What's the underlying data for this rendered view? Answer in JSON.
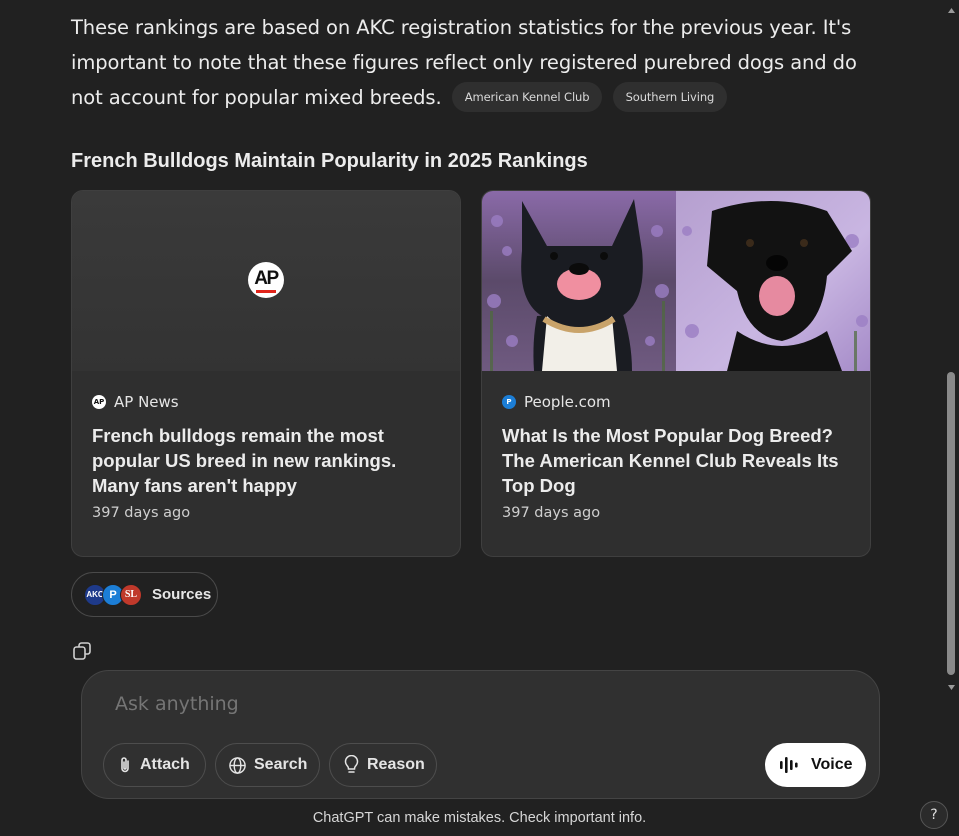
{
  "answer": {
    "paragraph": "These rankings are based on AKC registration statistics for the previous year. It's important to note that these figures reflect only registered purebred dogs and do not account for popular mixed breeds.",
    "citation_chips": [
      "American Kennel Club",
      "Southern Living"
    ]
  },
  "section_heading": "French Bulldogs Maintain Popularity in 2025 Rankings",
  "cards": [
    {
      "source": "AP News",
      "source_icon": "ap-logo-icon",
      "image_logo": "AP",
      "title": "French bulldogs remain the most popular US breed in new rankings. Many fans aren't happy",
      "date": "397 days ago"
    },
    {
      "source": "People.com",
      "source_icon": "people-logo-icon",
      "image": "french-bulldog-and-black-labrador-photo",
      "title": "What Is the Most Popular Dog Breed? The American Kennel Club Reveals Its Top Dog",
      "date": "397 days ago"
    }
  ],
  "sources_button": {
    "label": "Sources",
    "favicons": [
      "AKC",
      "P",
      "SL"
    ]
  },
  "composer": {
    "placeholder": "Ask anything",
    "buttons": {
      "attach": "Attach",
      "search": "Search",
      "reason": "Reason",
      "voice": "Voice"
    }
  },
  "footer": "ChatGPT can make mistakes. Check important info.",
  "help_label": "?",
  "colors": {
    "background": "#212121",
    "card": "#2f2f2f",
    "composer": "#303030",
    "voice_button": "#ffffff",
    "people_blue": "#1c7ed6",
    "ap_red": "#e1251b"
  }
}
